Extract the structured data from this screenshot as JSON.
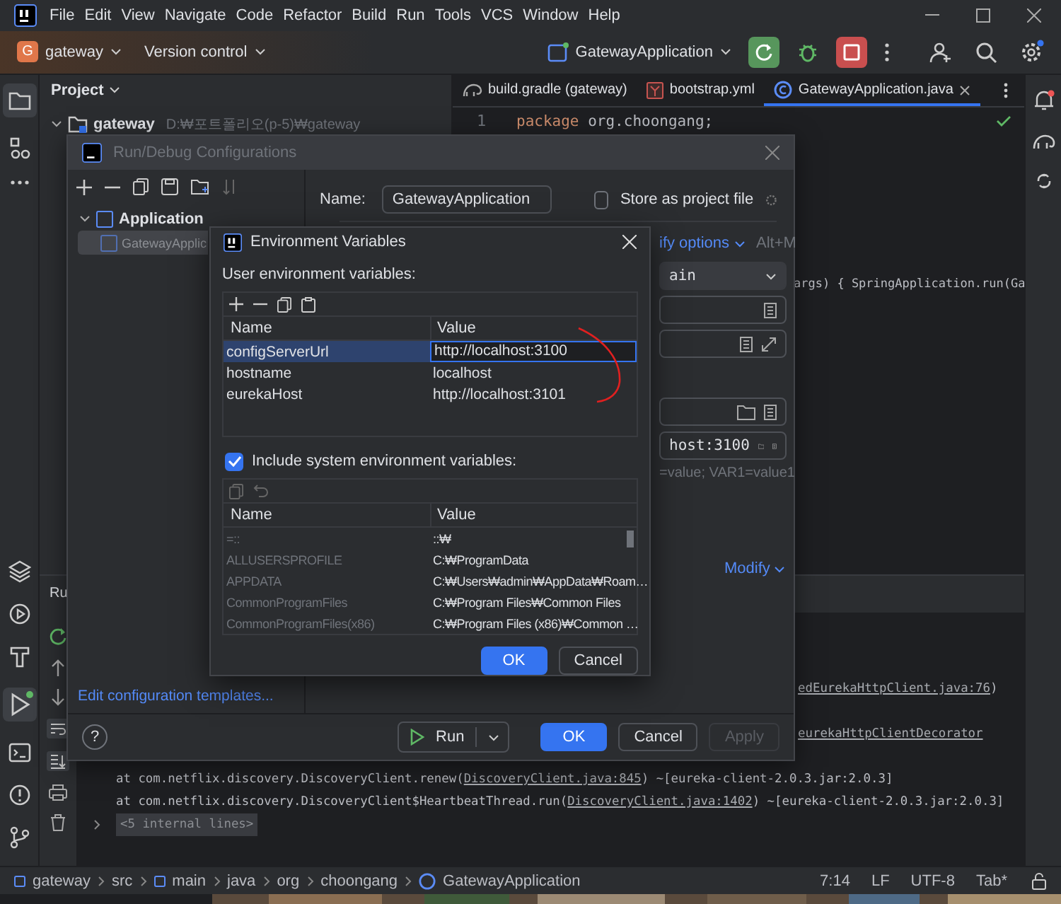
{
  "menu": [
    "File",
    "Edit",
    "View",
    "Navigate",
    "Code",
    "Refactor",
    "Build",
    "Run",
    "Tools",
    "VCS",
    "Window",
    "Help"
  ],
  "project": {
    "badge": "G",
    "name": "gateway",
    "vcs": "Version control"
  },
  "run_config": "GatewayApplication",
  "project_panel": {
    "title": "Project",
    "root": {
      "name": "gateway",
      "path": "D:₩포트폴리오(p-5)₩gateway",
      "expanded": true
    }
  },
  "editor_tabs": [
    {
      "label": "build.gradle (gateway)",
      "kind": "gradle",
      "selected": false
    },
    {
      "label": "bootstrap.yml",
      "kind": "yaml",
      "selected": false
    },
    {
      "label": "GatewayApplication.java",
      "kind": "java",
      "selected": true
    }
  ],
  "code": [
    {
      "number": "1",
      "keyword": "package",
      "text": " org.choongang;"
    }
  ],
  "code_fragment": "args) { SpringApplication.run(Ga",
  "run_panel": {
    "tab": "Ru",
    "console": [
      {
        "kind": "fragment",
        "link": "edEurekaHttpClient.java:76",
        "after": ")"
      },
      {
        "kind": "fragment",
        "link": "eurekaHttpClientDecorator"
      },
      {
        "kind": "line",
        "before": "at com.netflix.discovery.DiscoveryClient.renew(",
        "link": "DiscoveryClient.java:845",
        "after": ") ~[eureka-client-2.0.3.jar:2.0.3]"
      },
      {
        "kind": "line",
        "before": "at com.netflix.discovery.DiscoveryClient$HeartbeatThread.run(",
        "link": "DiscoveryClient.java:1402",
        "after": ") ~[eureka-client-2.0.3.jar:2.0.3]"
      },
      {
        "kind": "folded",
        "before": "<5 internal lines>"
      }
    ]
  },
  "run_dialog": {
    "title": "Run/Debug Configurations",
    "tree": {
      "label": "Application",
      "expanded": true,
      "children": [
        {
          "label": "GatewayApplic",
          "selected": true
        }
      ]
    },
    "name_label": "Name:",
    "name_value": "GatewayApplication",
    "store": {
      "label": "Store as project file",
      "checked": false
    },
    "modify_options": "ify options",
    "shortcut": "Alt+M",
    "main_class": "ain",
    "program_args": "host:3100",
    "env_hint": "=value; VAR1=value1",
    "modify": "Modify",
    "templates_link": "Edit configuration templates...",
    "help": "?",
    "run": "Run",
    "ok": "OK",
    "cancel": "Cancel",
    "apply": {
      "label": "Apply",
      "disabled": true
    }
  },
  "env_dialog": {
    "title": "Environment Variables",
    "user_label": "User environment variables:",
    "columns": [
      "Name",
      "Value"
    ],
    "rows": [
      {
        "name": "configServerUrl",
        "value": "http://localhost:3100",
        "selected": true
      },
      {
        "name": "hostname",
        "value": "localhost",
        "selected": false
      },
      {
        "name": "eurekaHost",
        "value": "http://localhost:3101",
        "selected": false
      }
    ],
    "include_system": {
      "label": "Include system environment variables:",
      "checked": true
    },
    "system_columns": [
      "Name",
      "Value"
    ],
    "system_rows": [
      {
        "name": "=::",
        "value": "::₩"
      },
      {
        "name": "ALLUSERSPROFILE",
        "value": "C:₩ProgramData"
      },
      {
        "name": "APPDATA",
        "value": "C:₩Users₩admin₩AppData₩Roam…"
      },
      {
        "name": "CommonProgramFiles",
        "value": "C:₩Program Files₩Common Files"
      },
      {
        "name": "CommonProgramFiles(x86)",
        "value": "C:₩Program Files (x86)₩Common …"
      }
    ],
    "ok": "OK",
    "cancel": "Cancel"
  },
  "status_bar": {
    "breadcrumbs": [
      "gateway",
      "src",
      "main",
      "java",
      "org",
      "choongang",
      "GatewayApplication"
    ],
    "items": [
      "7:14",
      "LF",
      "UTF-8",
      "Tab*"
    ]
  }
}
